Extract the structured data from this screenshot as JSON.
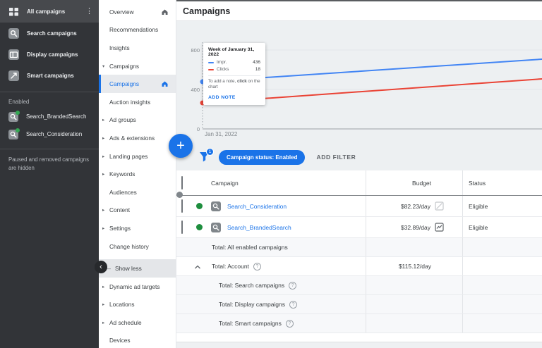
{
  "colors": {
    "accent": "#1a73e8",
    "impressions_line": "#4285f4",
    "clicks_line": "#ea4335",
    "enabled_dot": "#1e8e3e"
  },
  "header": {
    "title": "Campaigns"
  },
  "dark_sidebar": {
    "all_campaigns": "All campaigns",
    "items": [
      "Search campaigns",
      "Display campaigns",
      "Smart campaigns"
    ],
    "enabled_label": "Enabled",
    "enabled_campaigns": [
      "Search_BrandedSearch",
      "Search_Consideration"
    ],
    "hidden_note": "Paused and removed campaigns are hidden"
  },
  "nav": {
    "overview": "Overview",
    "recommendations": "Recommendations",
    "insights": "Insights",
    "campaigns_parent": "Campaigns",
    "campaigns": "Campaigns",
    "auction_insights": "Auction insights",
    "ad_groups": "Ad groups",
    "ads_extensions": "Ads & extensions",
    "landing_pages": "Landing pages",
    "keywords": "Keywords",
    "audiences": "Audiences",
    "content": "Content",
    "settings": "Settings",
    "change_history": "Change history",
    "show_less": "Show less",
    "dynamic_ad_targets": "Dynamic ad targets",
    "locations": "Locations",
    "ad_schedule": "Ad schedule",
    "devices": "Devices"
  },
  "chart_data": {
    "type": "line",
    "x_label": "Jan 31, 2022",
    "y_tick_labels": [
      "800",
      "400",
      "0"
    ],
    "ylim": [
      0,
      800
    ],
    "grid": true,
    "series": [
      {
        "name": "Impr.",
        "color": "#4285f4",
        "values": [
          436,
          700
        ],
        "note": "second value estimated from line position"
      },
      {
        "name": "Clicks",
        "color": "#ea4335",
        "values": [
          18,
          30
        ],
        "note": "own hidden scale; second value estimated"
      }
    ]
  },
  "tooltip": {
    "title": "Week of January 31, 2022",
    "impr_label": "Impr.",
    "impr_value": "436",
    "clicks_label": "Clicks",
    "clicks_value": "18",
    "note_pre": "To add a note, ",
    "note_bold": "click",
    "note_post": " on the chart",
    "add_note": "ADD NOTE"
  },
  "filter_bar": {
    "badge": "1",
    "chip": "Campaign status: Enabled",
    "add_filter": "ADD FILTER"
  },
  "table": {
    "headers": {
      "campaign": "Campaign",
      "budget": "Budget",
      "status": "Status"
    },
    "rows": [
      {
        "name": "Search_Consideration",
        "budget": "$82.23/day",
        "status": "Eligible"
      },
      {
        "name": "Search_BrandedSearch",
        "budget": "$32.89/day",
        "status": "Eligible"
      }
    ],
    "totals": [
      {
        "label": "Total: All enabled campaigns",
        "budget": ""
      },
      {
        "label": "Total: Account",
        "budget": "$115.12/day"
      },
      {
        "label": "Total: Search campaigns",
        "budget": ""
      },
      {
        "label": "Total: Display campaigns",
        "budget": ""
      },
      {
        "label": "Total: Smart campaigns",
        "budget": ""
      }
    ]
  }
}
